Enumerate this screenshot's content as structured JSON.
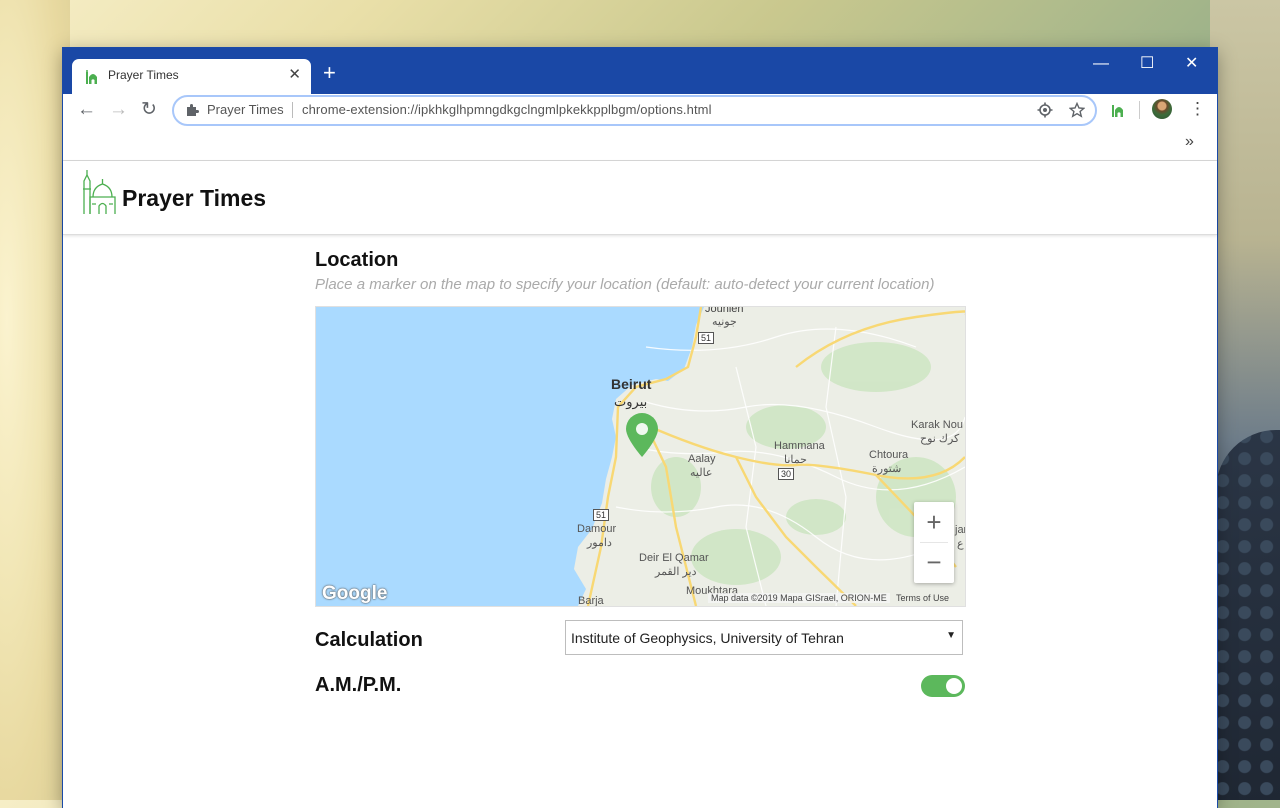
{
  "browser": {
    "tab_title": "Prayer Times",
    "tab_close": "✕",
    "new_tab": "+",
    "window_controls": {
      "minimize": "—",
      "maximize": "☐",
      "close": "✕"
    },
    "nav": {
      "back": "←",
      "forward": "→",
      "reload": "↻"
    },
    "omnibox": {
      "site_label": "Prayer Times",
      "url": "chrome-extension://ipkhkglhpmngdkgclngmlpkekkpplbgm/options.html"
    },
    "menu": "⋮",
    "bookmarks_overflow": "»"
  },
  "extension": {
    "title": "Prayer Times",
    "accent": "#5cb85c"
  },
  "location": {
    "label": "Location",
    "hint": "Place a marker on the map to specify your location (default: auto-detect your current location)"
  },
  "map": {
    "places": {
      "jounieh": "Jounieh",
      "jounieh_ar": "جونيه",
      "beirut": "Beirut",
      "beirut_ar": "بيروت",
      "hammana": "Hammana",
      "hammana_ar": "حمانا",
      "karak": "Karak Nou",
      "karak_ar": "كرك نوح",
      "aalay": "Aalay",
      "aalay_ar": "عاليه",
      "chtoura": "Chtoura",
      "chtoura_ar": "شتورة",
      "damour": "Damour",
      "damour_ar": "دامور",
      "deir": "Deir El Qamar",
      "deir_ar": "دير القمر",
      "moukhtara": "Moukhtara",
      "barja": "Barja",
      "zahle_cut": "jar",
      "zahle_cut2": "ع"
    },
    "shields": {
      "r51a": "51",
      "r51b": "51",
      "r30": "30"
    },
    "zoom_in": "+",
    "zoom_out": "−",
    "google": "Google",
    "attribution": "Map data ©2019 Mapa GISrael, ORION-ME",
    "terms": "Terms of Use"
  },
  "calculation": {
    "label": "Calculation",
    "selected": "Institute of Geophysics, University of Tehran"
  },
  "ampm": {
    "label": "A.M./P.M.",
    "enabled": true
  }
}
